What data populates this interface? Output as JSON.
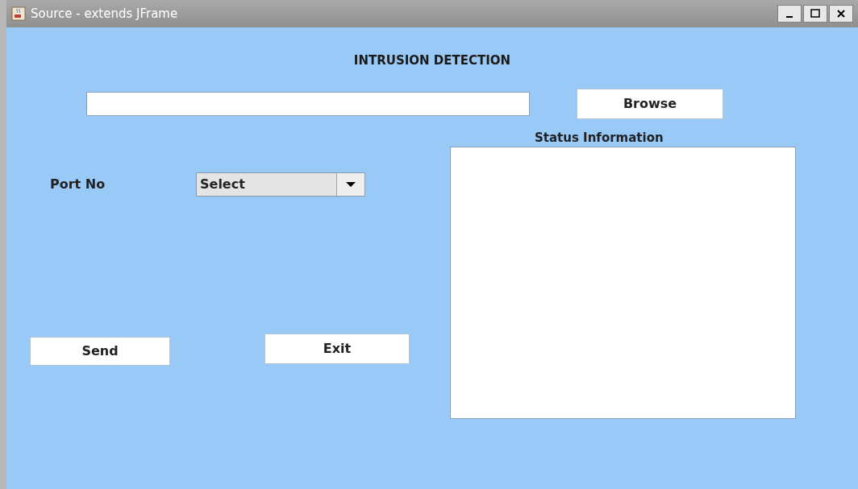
{
  "window": {
    "title": "Source - extends JFrame"
  },
  "heading": "INTRUSION DETECTION",
  "browse_button": "Browse",
  "status": {
    "label": "Status Information"
  },
  "port": {
    "label": "Port No",
    "value": "Select"
  },
  "buttons": [
    {
      "label": "Send"
    },
    {
      "label": "Exit"
    }
  ]
}
